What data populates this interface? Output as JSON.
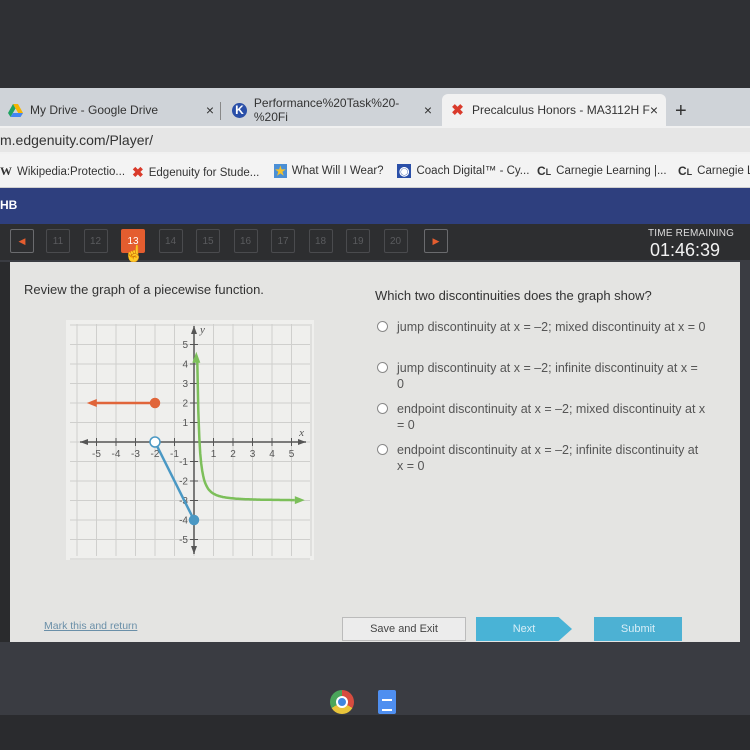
{
  "browser": {
    "tabs": [
      {
        "title": "My Drive - Google Drive",
        "icon": "google-drive-icon",
        "active": false
      },
      {
        "title": "Performance%20Task%20-%20Fi",
        "icon": "k-circle-icon",
        "active": false
      },
      {
        "title": "Precalculus Honors - MA3112H F",
        "icon": "edgenuity-x-icon",
        "active": true
      }
    ],
    "new_tab": "+",
    "close_glyph": "×",
    "url": "m.edgenuity.com/Player/",
    "bookmarks": [
      {
        "label": "Wikipedia:Protectio...",
        "icon": "wikipedia-icon",
        "glyph": "W"
      },
      {
        "label": "Edgenuity for Stude...",
        "icon": "edgenuity-x-icon",
        "glyph": "✖"
      },
      {
        "label": "What Will I Wear?",
        "icon": "star-icon",
        "glyph": "★"
      },
      {
        "label": "Coach Digital™ - Cy...",
        "icon": "coach-digital-icon",
        "glyph": "◉"
      },
      {
        "label": "Carnegie Learning |...",
        "icon": "carnegie-icon",
        "glyph": "CL"
      },
      {
        "label": "Carnegie L",
        "icon": "carnegie-icon",
        "glyph": "CL"
      }
    ]
  },
  "app": {
    "header_text": "HB",
    "nav": {
      "prev_glyph": "◀",
      "next_glyph": "▶",
      "questions": [
        "11",
        "12",
        "13",
        "14",
        "15",
        "16",
        "17",
        "18",
        "19",
        "20"
      ],
      "current": "13"
    },
    "timer_label": "TIME REMAINING",
    "timer_value": "01:46:39"
  },
  "content": {
    "prompt": "Review the graph of a piecewise function.",
    "question": "Which two discontinuities does the graph show?",
    "options": [
      "jump discontinuity at x = –2; mixed discontinuity at x = 0",
      "jump discontinuity at x = –2; infinite discontinuity at x = 0",
      "endpoint discontinuity at x = –2; mixed discontinuity at x = 0",
      "endpoint discontinuity at x = –2; infinite discontinuity at x = 0"
    ],
    "graph": {
      "x_label": "x",
      "y_label": "y",
      "x_ticks": [
        "-5",
        "-4",
        "-3",
        "-2",
        "-1",
        "1",
        "2",
        "3",
        "4",
        "5"
      ],
      "y_ticks": [
        "5",
        "4",
        "3",
        "2",
        "1",
        "-1",
        "-2",
        "-3",
        "-4",
        "-5"
      ],
      "pieces": [
        {
          "name": "orange-ray",
          "color": "#e0653a",
          "type": "ray-left",
          "endpoint": [
            -2,
            2
          ],
          "endpoint_closed": true
        },
        {
          "name": "blue-segment",
          "color": "#4a98c4",
          "type": "segment",
          "from": [
            -2,
            0
          ],
          "to": [
            0,
            -4
          ],
          "from_closed": false,
          "to_closed": true
        },
        {
          "name": "green-curve",
          "color": "#7cbf5a",
          "type": "curve",
          "vertical_asymptote_x": 0,
          "horizontal_asymptote_y": -3
        }
      ]
    }
  },
  "footer": {
    "mark_link": "Mark this and return",
    "save_exit": "Save and Exit",
    "next": "Next",
    "submit": "Submit"
  }
}
